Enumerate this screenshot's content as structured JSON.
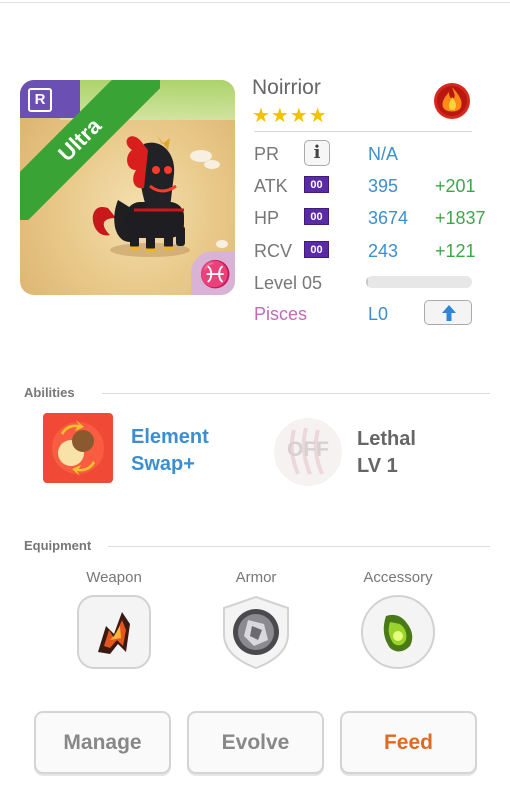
{
  "monster": {
    "name": "Noirrior",
    "stars": "★★★★",
    "star_count": 4,
    "rarity_badge": "R",
    "ribbon": "Ultra",
    "zodiac_symbol": "♓",
    "element_icon": "fire-icon"
  },
  "stats": {
    "pr": {
      "label": "PR",
      "value": "N/A",
      "info": "i"
    },
    "atk": {
      "label": "ATK",
      "badge": "00",
      "value": "395",
      "bonus": "+201"
    },
    "hp": {
      "label": "HP",
      "badge": "00",
      "value": "3674",
      "bonus": "+1837"
    },
    "rcv": {
      "label": "RCV",
      "badge": "00",
      "value": "243",
      "bonus": "+121"
    },
    "level": {
      "label": "Level 05",
      "progress_fraction": 0.02
    },
    "zodiac": {
      "label": "Pisces",
      "value": "L0"
    }
  },
  "abilities": {
    "title": "Abilities",
    "ability1": {
      "line1": "Element",
      "line2": "Swap+",
      "icon": "element-swap-icon"
    },
    "ability2": {
      "off_label": "OFF",
      "line1": "Lethal",
      "line2": "LV 1",
      "icon": "claw-icon"
    }
  },
  "equipment": {
    "title": "Equipment",
    "weapon": "Weapon",
    "armor": "Armor",
    "accessory": "Accessory"
  },
  "actions": {
    "manage": "Manage",
    "evolve": "Evolve",
    "feed": "Feed"
  },
  "colors": {
    "accent_blue": "#3b8fd0",
    "bonus_green": "#3ea64a",
    "feed_orange": "#e06a21",
    "ribbon_green": "#3aa335",
    "rarity_purple": "#6b4fb3",
    "pisces_pink": "#c06ab8"
  }
}
